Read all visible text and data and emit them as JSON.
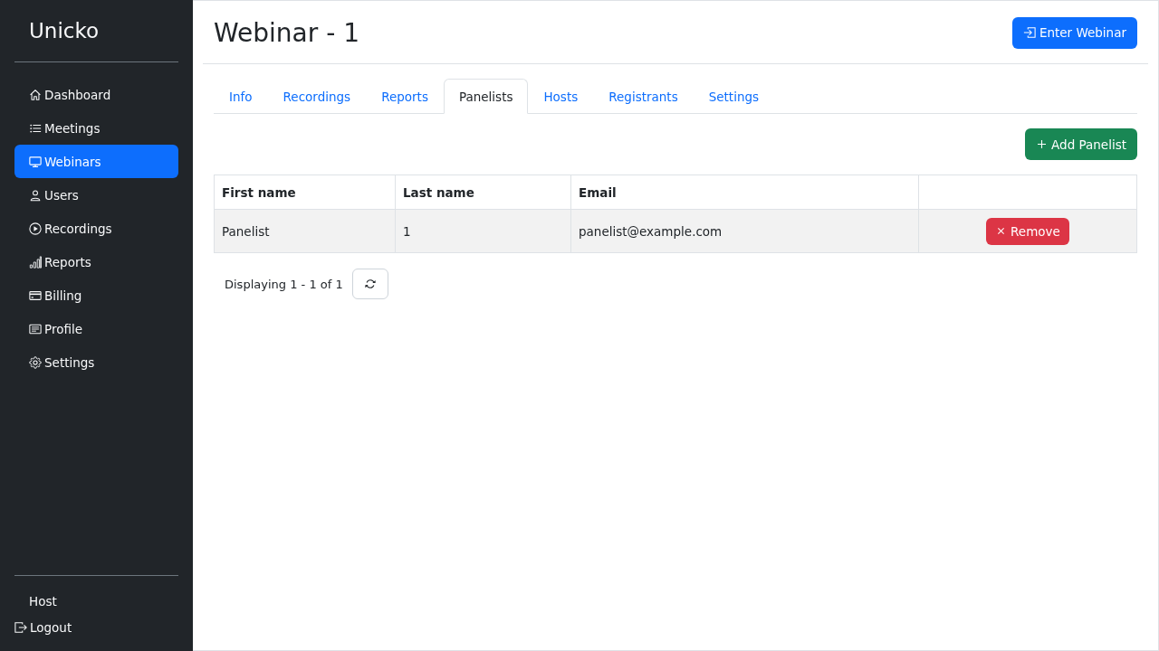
{
  "sidebar": {
    "brand": "Unicko",
    "items": [
      {
        "label": "Dashboard",
        "selected": false
      },
      {
        "label": "Meetings",
        "selected": false
      },
      {
        "label": "Webinars",
        "selected": true
      },
      {
        "label": "Users",
        "selected": false
      },
      {
        "label": "Recordings",
        "selected": false
      },
      {
        "label": "Reports",
        "selected": false
      },
      {
        "label": "Billing",
        "selected": false
      },
      {
        "label": "Profile",
        "selected": false
      },
      {
        "label": "Settings",
        "selected": false
      }
    ],
    "footer": {
      "user": "Host",
      "logout": "Logout"
    }
  },
  "header": {
    "title": "Webinar - 1",
    "action": "Enter Webinar"
  },
  "tabs": [
    {
      "label": "Info",
      "selected": false
    },
    {
      "label": "Recordings",
      "selected": false
    },
    {
      "label": "Reports",
      "selected": false
    },
    {
      "label": "Panelists",
      "selected": true
    },
    {
      "label": "Hosts",
      "selected": false
    },
    {
      "label": "Registrants",
      "selected": false
    },
    {
      "label": "Settings",
      "selected": false
    }
  ],
  "toolbar": {
    "add_button": "Add Panelist"
  },
  "table": {
    "columns": [
      "First name",
      "Last name",
      "Email"
    ],
    "rows": [
      {
        "first_name": "Panelist",
        "last_name": "1",
        "email": "panelist@example.com",
        "action": "Remove"
      }
    ]
  },
  "pagination": {
    "summary": "Displaying 1 - 1 of 1"
  }
}
